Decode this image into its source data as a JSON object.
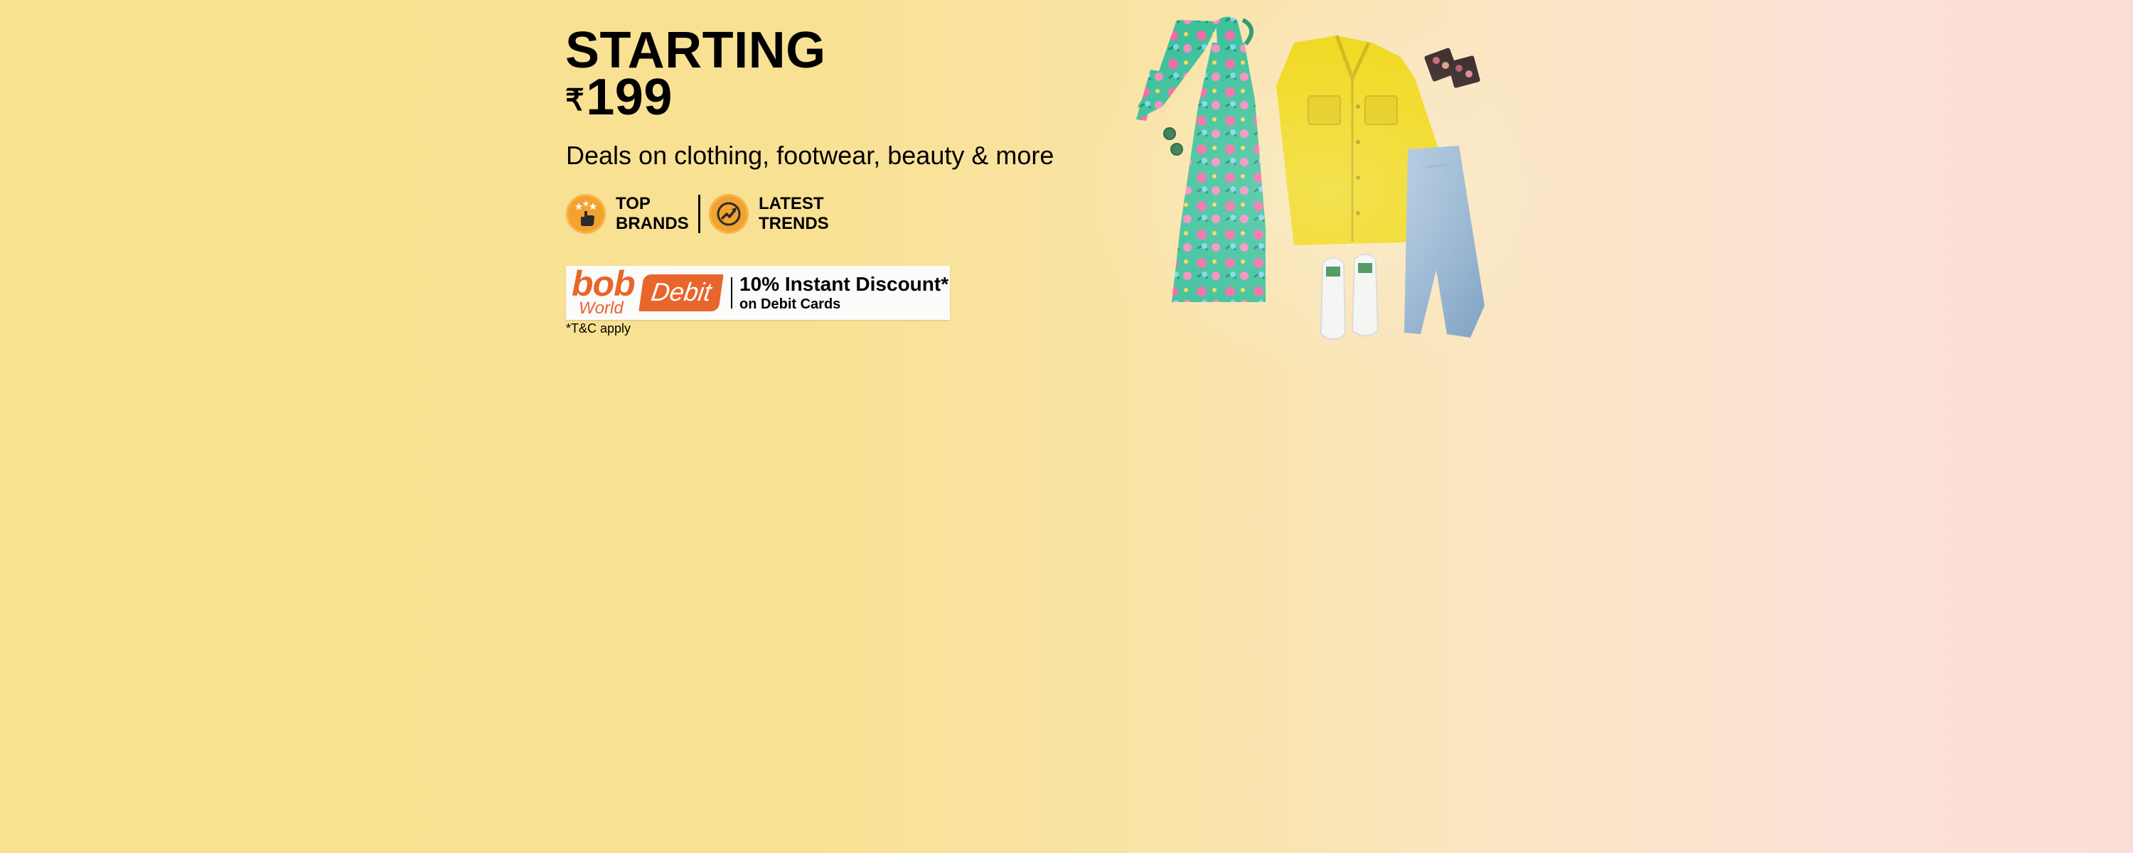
{
  "headline": {
    "line1": "STARTING",
    "currency": "₹",
    "price": "199"
  },
  "subtitle": "Deals on clothing, footwear, beauty & more",
  "features": [
    {
      "line1": "TOP",
      "line2": "BRANDS",
      "icon": "star-hand-icon"
    },
    {
      "line1": "LATEST",
      "line2": "TRENDS",
      "icon": "trend-arrow-icon"
    }
  ],
  "bank_offer": {
    "brand": "bob",
    "brand_sub": "World",
    "card_type": "Debit",
    "discount": "10% Instant Discount*",
    "detail": "on Debit Cards"
  },
  "tnc": "*T&C apply",
  "colors": {
    "background_left": "#f9e191",
    "background_right": "#fcded7",
    "accent_orange": "#e8652b",
    "icon_orange": "#f2a22e"
  }
}
